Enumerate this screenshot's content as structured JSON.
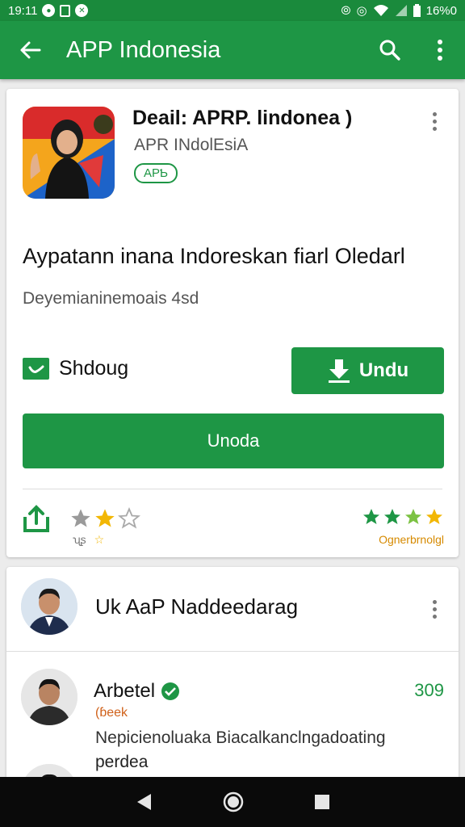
{
  "status_bar": {
    "time": "19:11",
    "battery": "16%0"
  },
  "app_bar": {
    "title": "APP Indonesia"
  },
  "app_card": {
    "title": "Deail: APRP. lindonea )",
    "subtitle": "APR INdolEsiA",
    "badge": "APƄ",
    "headline": "Aypatann inana Indoreskan fiarl Oledarl",
    "subline": "Deyemianinemoais 4sd",
    "checkbox_label": "Shdoug",
    "primary_button": "Undu",
    "wide_button": "Unoda",
    "left_rating": {
      "stars": 2,
      "sub_labels": [
        "ʯʂ",
        "☆"
      ]
    },
    "right_rating": {
      "stars": 4,
      "label": "Ognerbrnolgl"
    }
  },
  "developer_card": {
    "name": "Uk AaP Naddeedarag",
    "review": {
      "name": "Arbetel",
      "score": "309",
      "tag": "(ɓeek",
      "text": "Nepicienoluaka Biacalkanclngadoating",
      "text2": "perdea"
    }
  },
  "colors": {
    "brand_green": "#1e9645",
    "status_green": "#1a8a3c",
    "star_gold": "#f2b705"
  }
}
